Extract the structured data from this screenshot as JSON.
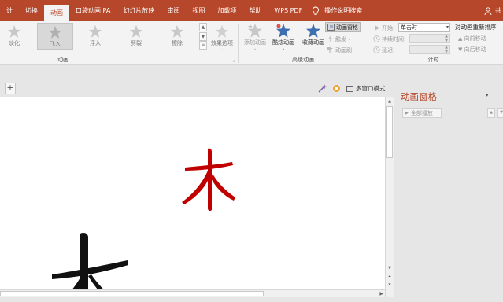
{
  "colors": {
    "accent": "#b7472a",
    "red_glyph": "#c00000",
    "ribbon_bg": "#f3f3f3"
  },
  "menu": {
    "items": [
      {
        "label": "计",
        "active": false
      },
      {
        "label": "切换",
        "active": false
      },
      {
        "label": "动画",
        "active": true
      },
      {
        "label": "口袋动画 PA",
        "active": false
      },
      {
        "label": "幻灯片放映",
        "active": false
      },
      {
        "label": "审阅",
        "active": false
      },
      {
        "label": "视图",
        "active": false
      },
      {
        "label": "加载项",
        "active": false
      },
      {
        "label": "帮助",
        "active": false
      },
      {
        "label": "WPS PDF",
        "active": false
      }
    ],
    "tell_me": "操作说明搜索",
    "user": "共"
  },
  "ribbon": {
    "animation_group": {
      "label": "动画",
      "effects": [
        {
          "label": "淡化",
          "icon": "star-icon"
        },
        {
          "label": "飞入",
          "icon": "star-icon",
          "selected": true
        },
        {
          "label": "浮入",
          "icon": "star-icon"
        },
        {
          "label": "劈裂",
          "icon": "star-icon"
        },
        {
          "label": "擦除",
          "icon": "star-icon"
        }
      ],
      "effect_options": "效果选项"
    },
    "advanced_group": {
      "label": "高级动画",
      "add_animation": "添加动画",
      "cool_animation": "酷炫动画",
      "collect_animation": "收藏动画",
      "animation_pane": "动画窗格",
      "trigger": "触发",
      "painter": "动画刷"
    },
    "timing_group": {
      "label": "计时",
      "start_label": "开始:",
      "start_value": "单击时",
      "duration_label": "持续时间:",
      "delay_label": "延迟:",
      "reorder_title": "对动画重新排序",
      "move_earlier": "向前移动",
      "move_later": "向后移动"
    }
  },
  "editor": {
    "multi_window": "多窗口模式",
    "glyph_red": "木",
    "glyph_black": "木"
  },
  "pane": {
    "title": "动画窗格",
    "play_all": "全部播放"
  }
}
